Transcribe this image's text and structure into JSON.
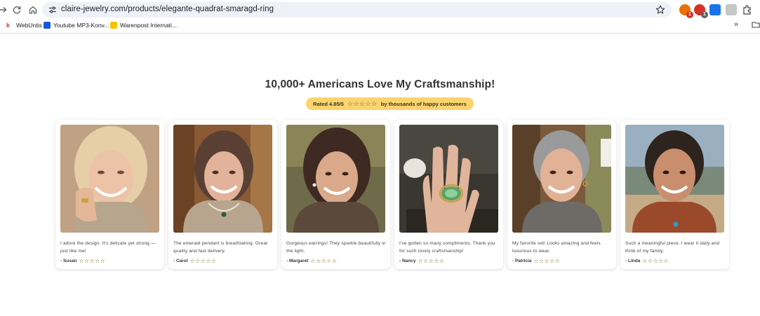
{
  "browser": {
    "url": "claire-jewelry.com/products/elegante-quadrat-smaragd-ring",
    "extensions": [
      {
        "name": "extension-1",
        "badge": "1",
        "color": "#e8710a",
        "badge_color": "#d93025"
      },
      {
        "name": "extension-2",
        "badge": "1",
        "color": "#d93025",
        "badge_color": "#5f6368"
      },
      {
        "name": "extension-translate",
        "badge": "",
        "color": "#1a73e8",
        "badge_color": ""
      },
      {
        "name": "extension-4",
        "badge": "",
        "color": "#c4c7c5",
        "badge_color": ""
      }
    ],
    "bookmarks": [
      {
        "label": "WebUntis",
        "icon": "webuntis-icon",
        "color": "#e03a3e"
      },
      {
        "label": "Youtube MP3-Konv...",
        "icon": "youtube-icon",
        "color": "#1a56db"
      },
      {
        "label": "Warenpost Internati...",
        "icon": "post-icon",
        "color": "#f5c400"
      }
    ]
  },
  "page": {
    "headline": "10,000+ Americans Love My Craftsmanship!",
    "rating_prefix": "Rated 4.85/5",
    "rating_stars": "☆☆☆☆☆",
    "rating_suffix": "by thousands of happy customers",
    "testimonials": [
      {
        "quote": "I adore the design. It's delicate yet strong — just like me!",
        "name": "- Susan",
        "stars": "☆☆☆☆☆",
        "rating": 5
      },
      {
        "quote": "The emerald pendant is breathtaking. Great quality and fast delivery.",
        "name": "- Carol",
        "stars": "☆☆☆☆☆",
        "rating": 5
      },
      {
        "quote": "Gorgeous earrings! They sparkle beautifully in the light.",
        "name": "- Margaret",
        "stars": "☆☆☆☆☆",
        "rating": 5
      },
      {
        "quote": "I've gotten so many compliments. Thank you for such lovely craftsmanship!",
        "name": "- Nancy",
        "stars": "☆☆☆☆☆",
        "rating": 5
      },
      {
        "quote": "My favorite set! Looks amazing and feels luxurious to wear.",
        "name": "- Patricia",
        "stars": "☆☆☆☆☆",
        "rating": 5
      },
      {
        "quote": "Such a meaningful piece. I wear it daily and think of my family.",
        "name": "- Linda",
        "stars": "☆☆☆☆☆",
        "rating": 5
      }
    ]
  },
  "colors": {
    "pill": "#fbd46d",
    "headline": "#333333",
    "star": "#7a6020"
  }
}
